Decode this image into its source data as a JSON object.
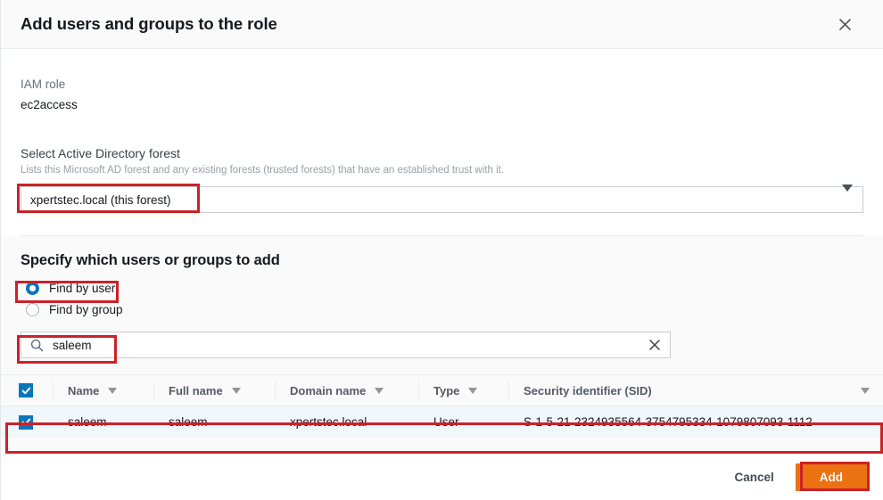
{
  "header": {
    "title": "Add users and groups to the role",
    "close_icon": "close-icon"
  },
  "iam_role": {
    "label": "IAM role",
    "value": "ec2access"
  },
  "forest": {
    "label": "Select Active Directory forest",
    "description": "Lists this Microsoft AD forest and any existing forests (trusted forests) that have an established trust with it.",
    "selected": "xpertstec.local (this forest)",
    "caret_icon": "chevron-down-icon"
  },
  "specify": {
    "heading": "Specify which users or groups to add",
    "radios": [
      {
        "label": "Find by user",
        "checked": true
      },
      {
        "label": "Find by group",
        "checked": false
      }
    ]
  },
  "search": {
    "value": "saleem",
    "placeholder": "Search",
    "icon": "search-icon",
    "clear_icon": "close-icon"
  },
  "table": {
    "select_all_checked": true,
    "columns": [
      {
        "label": "Name",
        "sortable": true
      },
      {
        "label": "Full name",
        "sortable": true
      },
      {
        "label": "Domain name",
        "sortable": true
      },
      {
        "label": "Type",
        "sortable": true
      },
      {
        "label": "Security identifier (SID)",
        "sortable": true
      }
    ],
    "rows": [
      {
        "checked": true,
        "name": "saleem",
        "full_name": "saleem",
        "domain_name": "xpertstec.local",
        "type": "User",
        "sid": "S-1-5-21-2324935564-3754795334-1079807093-1112"
      }
    ]
  },
  "footer": {
    "cancel_label": "Cancel",
    "add_label": "Add"
  },
  "colors": {
    "accent_blue": "#0a76ba",
    "primary_orange": "#ec7211",
    "annotation_red": "#cc2128",
    "selected_row": "#f1f8fc",
    "panel_grey": "#fafafa"
  }
}
